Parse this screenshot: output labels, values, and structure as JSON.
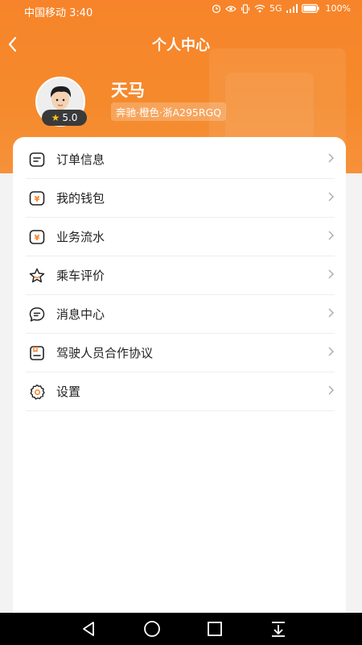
{
  "status_bar": {
    "carrier_time": "中国移动 3:40",
    "network": "5G",
    "battery": "100%"
  },
  "header": {
    "title": "个人中心"
  },
  "profile": {
    "name": "天马",
    "rating": "5.0",
    "car_info": "奔驰·橙色·浙A295RGQ"
  },
  "menu": [
    {
      "label": "订单信息",
      "icon": "order-list-icon"
    },
    {
      "label": "我的钱包",
      "icon": "wallet-icon"
    },
    {
      "label": "业务流水",
      "icon": "transactions-icon"
    },
    {
      "label": "乘车评价",
      "icon": "star-icon"
    },
    {
      "label": "消息中心",
      "icon": "message-icon"
    },
    {
      "label": "驾驶人员合作协议",
      "icon": "agreement-icon"
    },
    {
      "label": "设置",
      "icon": "gear-icon"
    }
  ],
  "colors": {
    "accent": "#f7842a",
    "nav_bar": "#000000"
  }
}
